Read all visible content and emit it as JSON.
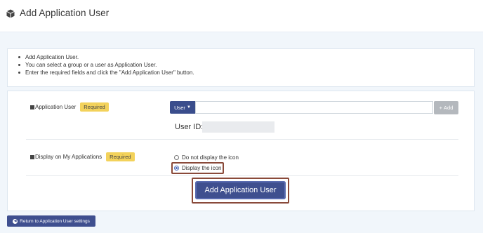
{
  "header": {
    "title": "Add Application User",
    "icon": "cube-icon"
  },
  "info": {
    "items": [
      "Add Application User.",
      "You can select a group or a user as Application User.",
      "Enter the required fields and click the \"Add Application User\" button."
    ]
  },
  "form": {
    "app_user": {
      "label": "Application User",
      "required": "Required",
      "type_select": "User",
      "input_value": "",
      "add_label": "Add",
      "user_id_label": "User ID:"
    },
    "display": {
      "label": "Display on My Applications",
      "required": "Required",
      "options": [
        "Do not display the icon",
        "Display the icon"
      ],
      "selected": "Display the icon"
    },
    "submit_label": "Add Application User"
  },
  "footer": {
    "return_label": "Return to Application User settings"
  },
  "colors": {
    "primary": "#3f4f8f",
    "badge": "#f3d25b",
    "highlight": "#8a4a3a",
    "background": "#f1f6fb"
  }
}
